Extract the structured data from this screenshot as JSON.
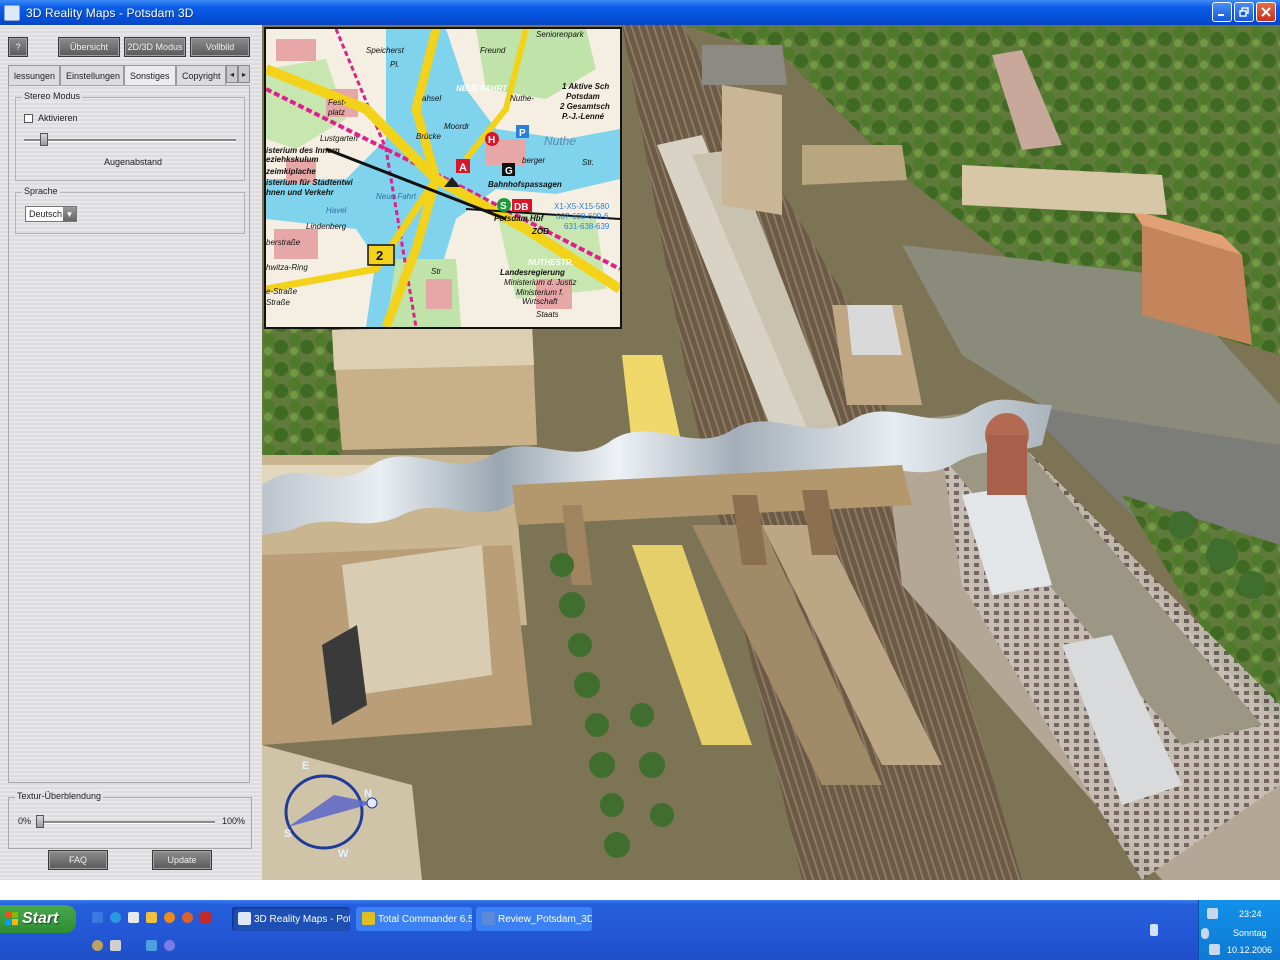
{
  "window": {
    "title": "3D Reality Maps - Potsdam 3D"
  },
  "panel": {
    "help_label": "?",
    "top_buttons": [
      "Übersicht",
      "2D/3D Modus",
      "Vollbild"
    ],
    "tabs": [
      "lessungen",
      "Einstellungen",
      "Sonstiges",
      "Copyright"
    ],
    "active_tab": "Sonstiges",
    "stereo": {
      "legend": "Stereo Modus",
      "checkbox_label": "Aktivieren",
      "checked": false,
      "slider_label": "Augenabstand"
    },
    "language": {
      "legend": "Sprache",
      "value": "Deutsch"
    },
    "texture": {
      "legend": "Textur-Überblendung",
      "min_label": "0%",
      "max_label": "100%"
    },
    "faq_label": "FAQ",
    "update_label": "Update"
  },
  "street_map": {
    "labels": [
      "Freund",
      "Seniorenpark",
      "1 Aktive Sch",
      "Potsdam",
      "2 Gesamtsch",
      "P.-J.-Lenné",
      "Nuthe",
      "isterium des Innern",
      "eziehkskulum",
      "zeimkiplache",
      "isterium für Stadtentwi",
      "hnen und Verkehr",
      "Lindenberg",
      "Bahnhofspassagen",
      "Potsdam Hbf",
      "ZOB",
      "X1-X5-X15-580",
      "607-608-609-6",
      "631-638-639",
      "berstraße",
      "hwitza-Ring",
      "e-Straße",
      "Straße",
      "Landesregierung",
      "Ministerium d. Justiz",
      "Ministerium f.",
      "Wirtschaft",
      "Staats",
      "NEUE FAHRT",
      "Neue Fahrt",
      "Havel",
      "Fest-",
      "platz",
      "Lustgarten",
      "ahsel",
      "Nuthe-",
      "berger",
      "Str.",
      "Str",
      "Brücke",
      "NUTHESTR.",
      "Moordr",
      "Pl.",
      "Speicherst"
    ],
    "route_number": "2",
    "badges": [
      "A",
      "DB",
      "S",
      "G",
      "P",
      "H"
    ]
  },
  "compass": {
    "letters": [
      "E",
      "N",
      "S",
      "W"
    ]
  },
  "taskbar": {
    "start_label": "Start",
    "tasks": [
      "3D Reality Maps - Pot...",
      "Total Commander 6.5 ...",
      "Review_Potsdam_3D ..."
    ],
    "clock": "23:24",
    "day": "Sonntag",
    "date": "10.12.2006"
  },
  "colors": {
    "title_blue": "#0a5ce8",
    "taskbar_blue": "#245edb",
    "tray_blue": "#0d7ad4",
    "start_green": "#3a9a3e",
    "map_yellow": "#f3d21a",
    "map_magenta": "#e0208a",
    "map_cyan": "#4ec8ea",
    "map_red": "#d8162a"
  }
}
